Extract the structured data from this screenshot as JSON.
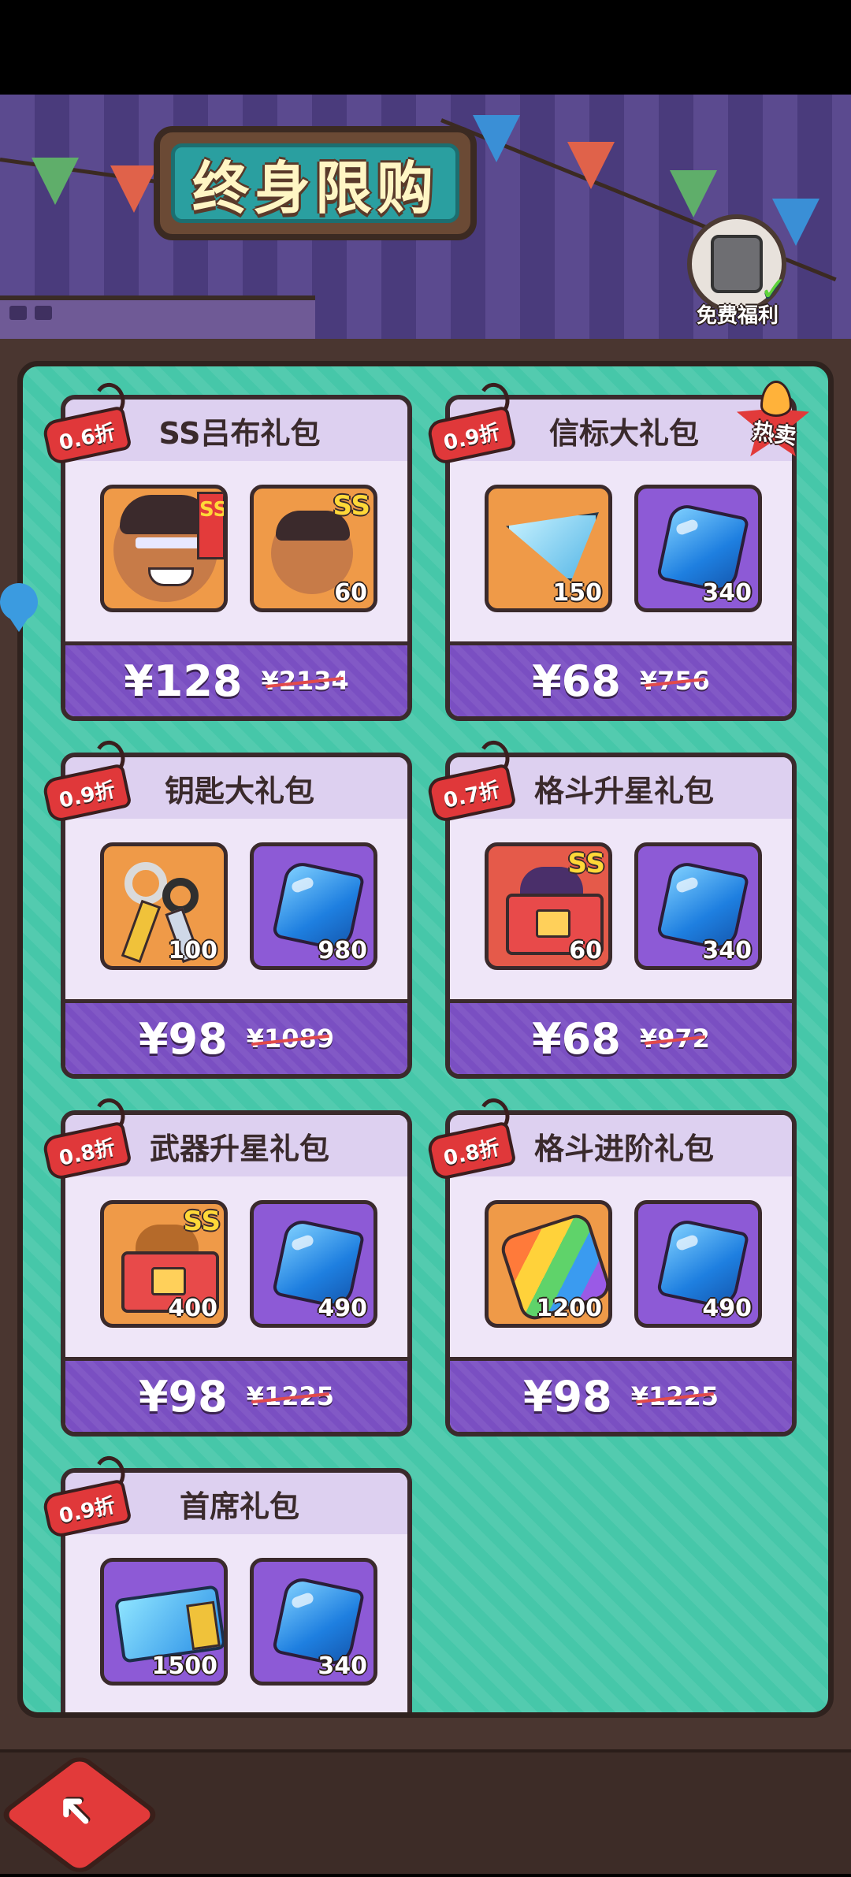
{
  "header": {
    "title": "终身限购",
    "free_welfare_label": "免费福利"
  },
  "colors": {
    "panel": "#46c7a9",
    "card": "#efe6f8",
    "price_bar": "#7a4fc2",
    "discount_tag": "#e0383a"
  },
  "packs": [
    {
      "name": "SS吕布礼包",
      "discount": "0.6折",
      "price": "¥128",
      "original_price": "¥2134",
      "hot": false,
      "items": [
        {
          "icon": "hero-lubu-portrait-icon",
          "qty": ""
        },
        {
          "icon": "hero-lubu-shard-icon",
          "qty": "60"
        }
      ]
    },
    {
      "name": "信标大礼包",
      "discount": "0.9折",
      "price": "¥68",
      "original_price": "¥756",
      "hot": true,
      "hot_label": "热卖",
      "items": [
        {
          "icon": "beacon-icon",
          "qty": "150"
        },
        {
          "icon": "gem-icon",
          "qty": "340"
        }
      ]
    },
    {
      "name": "钥匙大礼包",
      "discount": "0.9折",
      "price": "¥98",
      "original_price": "¥1089",
      "hot": false,
      "items": [
        {
          "icon": "keys-icon",
          "qty": "100"
        },
        {
          "icon": "gem-icon",
          "qty": "980"
        }
      ]
    },
    {
      "name": "格斗升星礼包",
      "discount": "0.7折",
      "price": "¥68",
      "original_price": "¥972",
      "hot": false,
      "items": [
        {
          "icon": "fighter-star-chest-icon",
          "qty": "60"
        },
        {
          "icon": "gem-icon",
          "qty": "340"
        }
      ]
    },
    {
      "name": "武器升星礼包",
      "discount": "0.8折",
      "price": "¥98",
      "original_price": "¥1225",
      "hot": false,
      "items": [
        {
          "icon": "weapon-star-chest-icon",
          "qty": "400"
        },
        {
          "icon": "gem-icon",
          "qty": "490"
        }
      ]
    },
    {
      "name": "格斗进阶礼包",
      "discount": "0.8折",
      "price": "¥98",
      "original_price": "¥1225",
      "hot": false,
      "items": [
        {
          "icon": "puzzle-piece-icon",
          "qty": "1200"
        },
        {
          "icon": "gem-icon",
          "qty": "490"
        }
      ]
    },
    {
      "name": "首席礼包",
      "discount": "0.9折",
      "price": "",
      "original_price": "",
      "hot": false,
      "items": [
        {
          "icon": "chip-card-icon",
          "qty": "1500"
        },
        {
          "icon": "gem-icon",
          "qty": "340"
        }
      ]
    }
  ],
  "ss_badge": "SS"
}
